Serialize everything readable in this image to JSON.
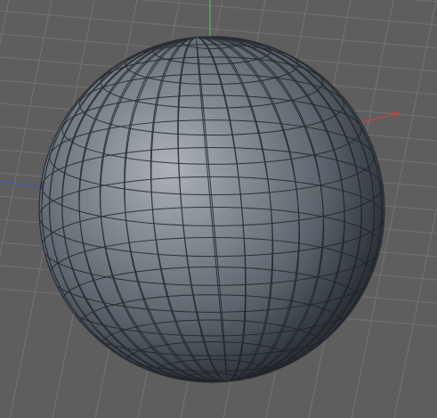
{
  "viewport": {
    "background_color": "#5e5e5e",
    "grid_color": "#767676",
    "object": {
      "name": "sphere",
      "base_color": "#707780",
      "highlight_color": "#a9aeb4",
      "shadow_color": "#2f353b",
      "wire_color": "#1f2328"
    },
    "axes": {
      "x_color": "#d93b3b",
      "y_color": "#4fd14f",
      "z_color": "#3b55d9"
    }
  }
}
